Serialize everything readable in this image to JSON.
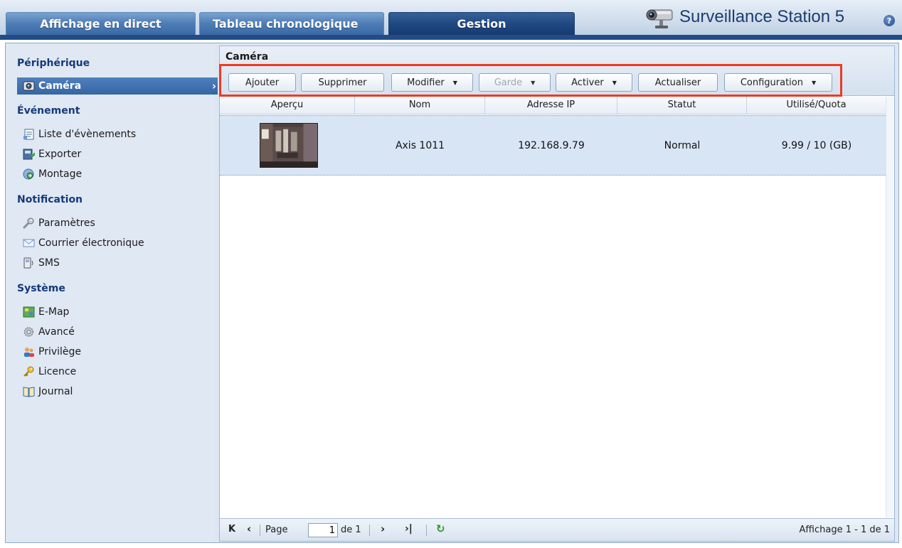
{
  "header": {
    "tabs": [
      {
        "label": "Affichage en direct",
        "active": false
      },
      {
        "label": "Tableau chronologique",
        "active": false
      },
      {
        "label": "Gestion",
        "active": true
      }
    ],
    "app_title": "Surveillance Station 5",
    "help_symbol": "?"
  },
  "sidebar": {
    "sections": [
      {
        "title": "Périphérique",
        "items": [
          {
            "label": "Caméra",
            "icon": "camera-icon",
            "selected": true
          }
        ]
      },
      {
        "title": "Événement",
        "items": [
          {
            "label": "Liste d'évènements",
            "icon": "event-list-icon"
          },
          {
            "label": "Exporter",
            "icon": "export-icon"
          },
          {
            "label": "Montage",
            "icon": "montage-icon"
          }
        ]
      },
      {
        "title": "Notification",
        "items": [
          {
            "label": "Paramètres",
            "icon": "wrench-icon"
          },
          {
            "label": "Courrier électronique",
            "icon": "envelope-icon"
          },
          {
            "label": "SMS",
            "icon": "sms-phone-icon"
          }
        ]
      },
      {
        "title": "Système",
        "items": [
          {
            "label": "E-Map",
            "icon": "emap-icon"
          },
          {
            "label": "Avancé",
            "icon": "gear-icon"
          },
          {
            "label": "Privilège",
            "icon": "users-icon"
          },
          {
            "label": "Licence",
            "icon": "key-icon"
          },
          {
            "label": "Journal",
            "icon": "book-icon"
          }
        ]
      }
    ],
    "selected_chevron": "›"
  },
  "panel": {
    "title": "Caméra",
    "toolbar": {
      "add": "Ajouter",
      "delete": "Supprimer",
      "edit": "Modifier",
      "guard": "Garde",
      "enable": "Activer",
      "refresh": "Actualiser",
      "config": "Configuration"
    },
    "columns": [
      "Aperçu",
      "Nom",
      "Adresse IP",
      "Statut",
      "Utilisé/Quota"
    ],
    "rows": [
      {
        "name": "Axis 1011",
        "ip": "192.168.9.79",
        "status": "Normal",
        "quota": "9.99 / 10 (GB)"
      }
    ],
    "paging": {
      "first": "K",
      "prev": "‹",
      "page_label": "Page",
      "page_value": "1",
      "of_label": "de 1",
      "next": "›",
      "last": "›|",
      "refresh": "↻",
      "display": "Affichage 1 - 1 de 1"
    }
  },
  "colors": {
    "accent": "#1e4781",
    "highlight": "#ef3a22",
    "row_selected": "#d8e5f5",
    "section_title": "#15397a"
  }
}
